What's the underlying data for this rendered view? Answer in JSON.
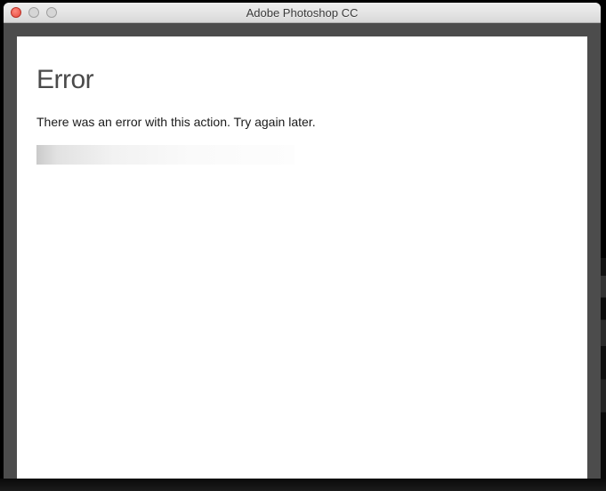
{
  "window": {
    "title": "Adobe Photoshop CC"
  },
  "dialog": {
    "heading": "Error",
    "message": "There was an error with this action. Try again later."
  }
}
